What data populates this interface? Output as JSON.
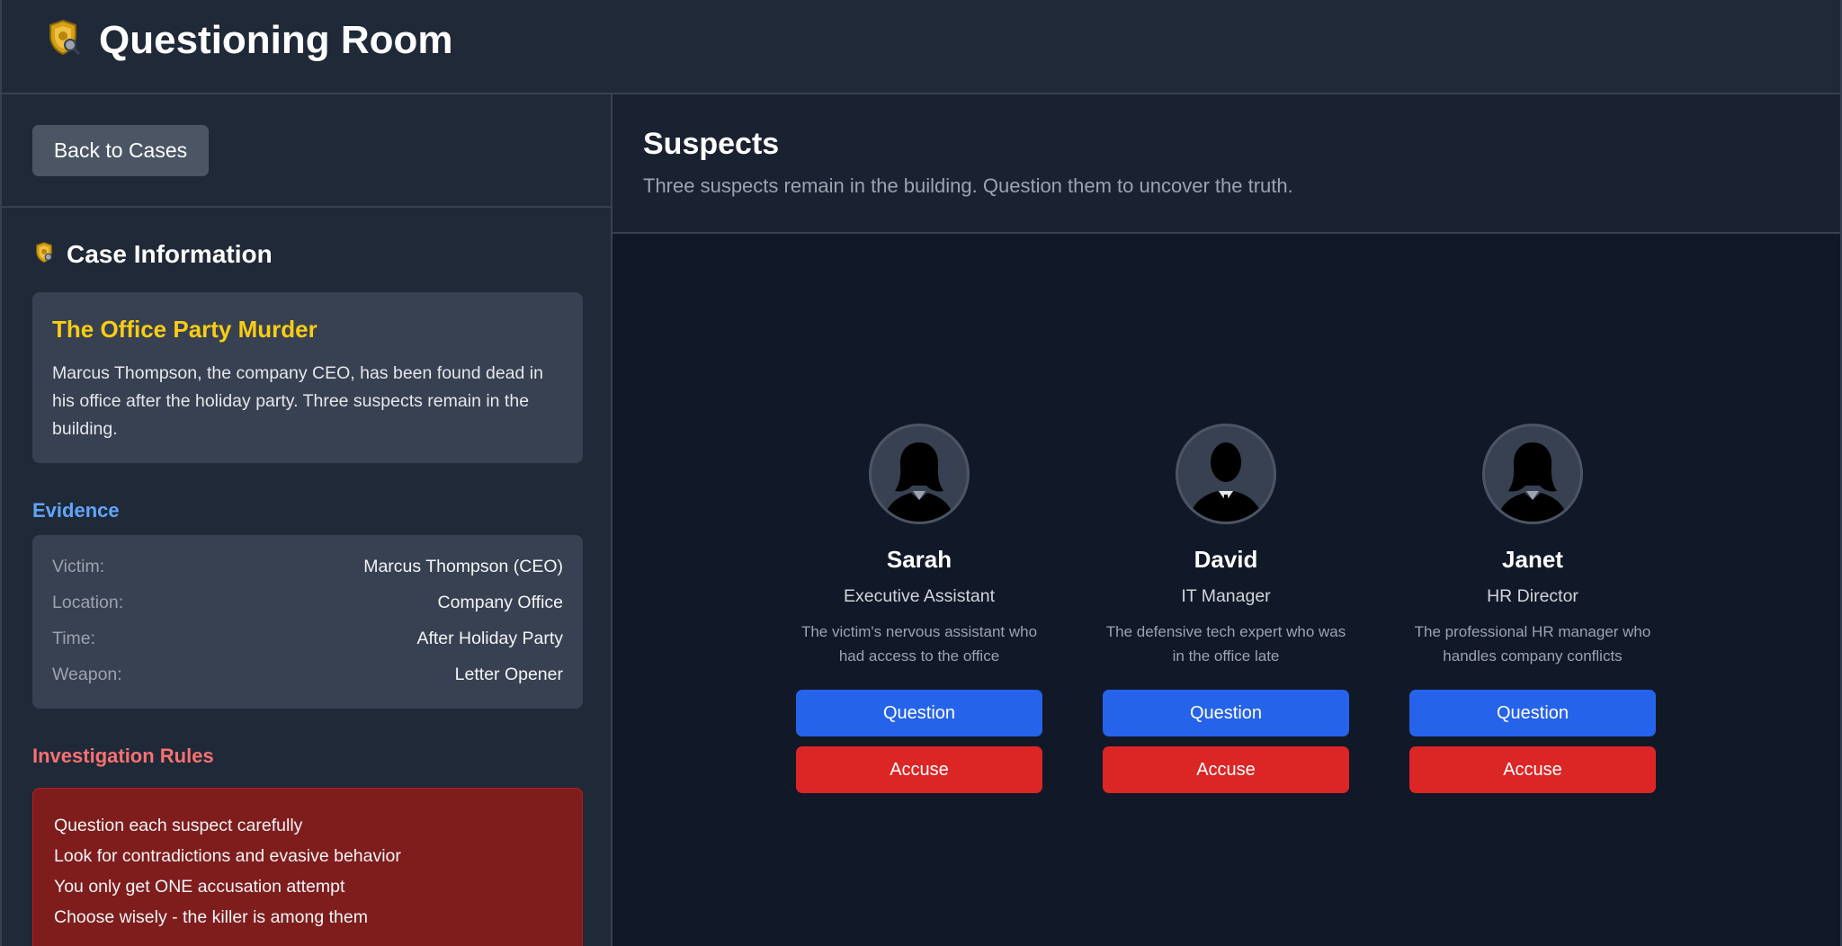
{
  "header": {
    "title": "Questioning Room",
    "icon": "police-badge-icon"
  },
  "sidebar": {
    "back_label": "Back to Cases",
    "case_info_label": "Case Information",
    "case": {
      "title": "The Office Party Murder",
      "description": "Marcus Thompson, the company CEO, has been found dead in his office after the holiday party. Three suspects remain in the building."
    },
    "evidence_label": "Evidence",
    "evidence": [
      {
        "key": "Victim:",
        "value": "Marcus Thompson (CEO)"
      },
      {
        "key": "Location:",
        "value": "Company Office"
      },
      {
        "key": "Time:",
        "value": "After Holiday Party"
      },
      {
        "key": "Weapon:",
        "value": "Letter Opener"
      }
    ],
    "rules_label": "Investigation Rules",
    "rules": [
      "Question each suspect carefully",
      "Look for contradictions and evasive behavior",
      "You only get ONE accusation attempt",
      "Choose wisely - the killer is among them"
    ]
  },
  "main": {
    "title": "Suspects",
    "subtitle": "Three suspects remain in the building. Question them to uncover the truth.",
    "question_label": "Question",
    "accuse_label": "Accuse",
    "suspects": [
      {
        "name": "Sarah",
        "role": "Executive Assistant",
        "description": "The victim's nervous assistant who had access to the office",
        "avatar": "female-silhouette-icon"
      },
      {
        "name": "David",
        "role": "IT Manager",
        "description": "The defensive tech expert who was in the office late",
        "avatar": "male-silhouette-icon"
      },
      {
        "name": "Janet",
        "role": "HR Director",
        "description": "The professional HR manager who handles company conflicts",
        "avatar": "female-silhouette-icon"
      }
    ]
  },
  "colors": {
    "background": "#111827",
    "panel": "#1f2937",
    "card": "#374151",
    "case_title": "#facc15",
    "evidence_label": "#60a5fa",
    "rules_label": "#f87171",
    "rules_card": "#7f1d1d",
    "question_button": "#2563eb",
    "accuse_button": "#dc2626"
  }
}
